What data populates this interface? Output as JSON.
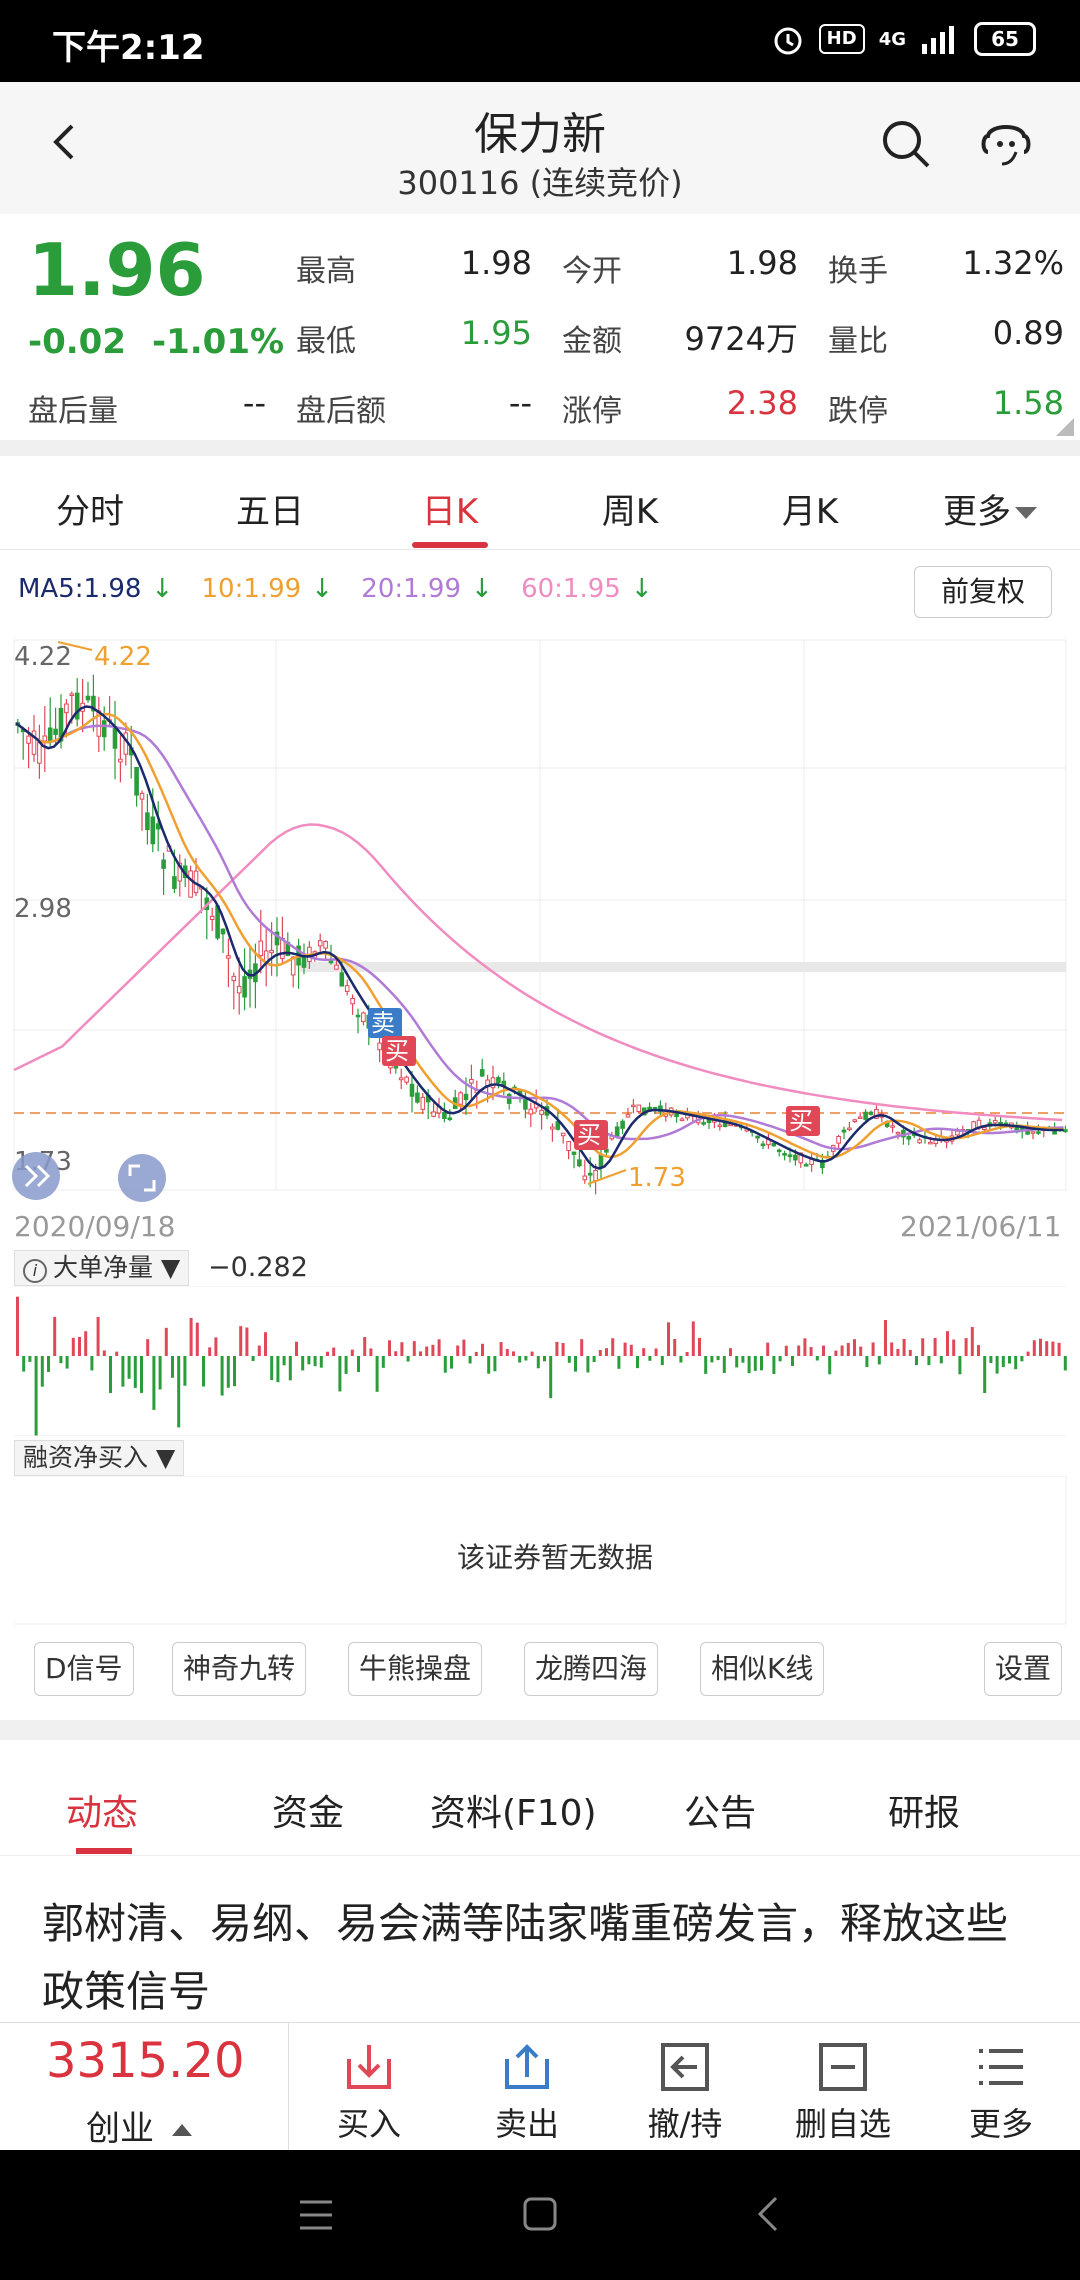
{
  "status": {
    "time": "下午2:12",
    "hd": "HD",
    "net": "4G",
    "battery": "65"
  },
  "header": {
    "title": "保力新",
    "subtitle": "300116 (连续竞价)"
  },
  "quote": {
    "price": "1.96",
    "change": "-0.02",
    "change_pct": "-1.01%",
    "fields": [
      {
        "label": "最高",
        "value": "1.98"
      },
      {
        "label": "今开",
        "value": "1.98"
      },
      {
        "label": "换手",
        "value": "1.32%"
      },
      {
        "label": "最低",
        "value": "1.95"
      },
      {
        "label": "金额",
        "value": "9724万"
      },
      {
        "label": "量比",
        "value": "0.89"
      },
      {
        "label": "盘后量",
        "value": "--"
      },
      {
        "label": "盘后额",
        "value": "--"
      },
      {
        "label": "涨停",
        "value": "2.38"
      },
      {
        "label": "跌停",
        "value": "1.58"
      }
    ]
  },
  "period_tabs": [
    "分时",
    "五日",
    "日K",
    "周K",
    "月K",
    "更多"
  ],
  "active_period": "日K",
  "ma": {
    "ma5": "MA5:1.98",
    "ma10": "10:1.99",
    "ma20": "20:1.99",
    "ma60": "60:1.95",
    "arrow": "↓",
    "colors": {
      "ma5": "#1a2a6c",
      "ma10": "#f0a030",
      "ma20": "#b07ad6",
      "ma60": "#f08cc0"
    }
  },
  "fq_button": "前复权",
  "kchart": {
    "y_high": "4.22",
    "y_mid": "2.98",
    "y_low": "1.73",
    "max_mark": "4.22",
    "min_mark": "1.73",
    "start_date": "2020/09/18",
    "end_date": "2021/06/11",
    "signals": [
      "卖",
      "买",
      "买",
      "买"
    ]
  },
  "indicator1": {
    "name": "大单净量 ▼",
    "value": "−0.282"
  },
  "indicator2": {
    "name": "融资净买入 ▼",
    "empty_text": "该证券暂无数据"
  },
  "tools": [
    "D信号",
    "神奇九转",
    "牛熊操盘",
    "龙腾四海",
    "相似K线",
    "设置"
  ],
  "info_tabs": [
    "动态",
    "资金",
    "资料(F10)",
    "公告",
    "研报"
  ],
  "news_headline": "郭树清、易纲、易会满等陆家嘴重磅发言，释放这些政策信号",
  "bottom": {
    "index_value": "3315.20",
    "index_name": "创业",
    "actions": [
      "买入",
      "卖出",
      "撤/持",
      "删自选",
      "更多"
    ]
  }
}
